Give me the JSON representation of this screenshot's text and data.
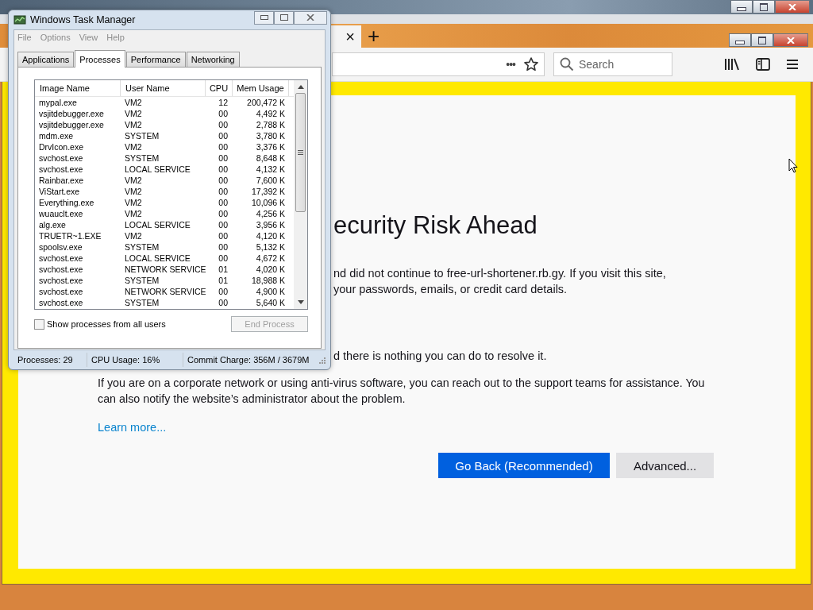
{
  "browser": {
    "tab": {
      "close": "×"
    },
    "new_tab": "+",
    "url_menu": "•••",
    "search": {
      "placeholder": "Search"
    },
    "page": {
      "heading": "ecurity Risk Ahead",
      "blocks": [
        {
          "kind": "clipped",
          "lines": [
            "nd did not continue to free-url-shortener.rb.gy. If you visit this site,",
            "your passwords, emails, or credit card details."
          ]
        },
        {
          "kind": "clipped",
          "lines": [
            "d there is nothing you can do to resolve it."
          ]
        },
        {
          "kind": "full",
          "text": "If you are on a corporate network or using anti-virus software, you can reach out to the support teams for assistance. You can also notify the website’s administrator about the problem."
        }
      ],
      "learn_more": "Learn more...",
      "buttons": [
        {
          "label": "Go Back (Recommended)",
          "kind": "primary"
        },
        {
          "label": "Advanced...",
          "kind": "secondary"
        }
      ]
    }
  },
  "task_manager": {
    "title": "Windows Task Manager",
    "menu": [
      "File",
      "Options",
      "View",
      "Help"
    ],
    "tabs": [
      {
        "label": "Applications",
        "selected": false
      },
      {
        "label": "Processes",
        "selected": true
      },
      {
        "label": "Performance",
        "selected": false
      },
      {
        "label": "Networking",
        "selected": false
      }
    ],
    "columns": [
      "Image Name",
      "User Name",
      "CPU",
      "Mem Usage"
    ],
    "rows": [
      [
        "mypal.exe",
        "VM2",
        "12",
        "200,472 K"
      ],
      [
        "vsjitdebugger.exe",
        "VM2",
        "00",
        "4,492 K"
      ],
      [
        "vsjitdebugger.exe",
        "VM2",
        "00",
        "2,788 K"
      ],
      [
        "mdm.exe",
        "SYSTEM",
        "00",
        "3,780 K"
      ],
      [
        "DrvIcon.exe",
        "VM2",
        "00",
        "3,376 K"
      ],
      [
        "svchost.exe",
        "SYSTEM",
        "00",
        "8,648 K"
      ],
      [
        "svchost.exe",
        "LOCAL SERVICE",
        "00",
        "4,132 K"
      ],
      [
        "Rainbar.exe",
        "VM2",
        "00",
        "7,600 K"
      ],
      [
        "ViStart.exe",
        "VM2",
        "00",
        "17,392 K"
      ],
      [
        "Everything.exe",
        "VM2",
        "00",
        "10,096 K"
      ],
      [
        "wuauclt.exe",
        "VM2",
        "00",
        "4,256 K"
      ],
      [
        "alg.exe",
        "LOCAL SERVICE",
        "00",
        "3,956 K"
      ],
      [
        "TRUETR~1.EXE",
        "VM2",
        "00",
        "4,120 K"
      ],
      [
        "spoolsv.exe",
        "SYSTEM",
        "00",
        "5,132 K"
      ],
      [
        "svchost.exe",
        "LOCAL SERVICE",
        "00",
        "4,672 K"
      ],
      [
        "svchost.exe",
        "NETWORK SERVICE",
        "01",
        "4,020 K"
      ],
      [
        "svchost.exe",
        "SYSTEM",
        "01",
        "18,988 K"
      ],
      [
        "svchost.exe",
        "NETWORK SERVICE",
        "00",
        "4,900 K"
      ],
      [
        "svchost.exe",
        "SYSTEM",
        "00",
        "5,640 K"
      ]
    ],
    "show_all": {
      "label": "Show processes from all users",
      "checked": false
    },
    "end_process": {
      "label": "End Process",
      "disabled": true
    },
    "status": [
      "Processes: 29",
      "CPU Usage: 16%",
      "Commit Charge: 356M / 3679M"
    ]
  }
}
